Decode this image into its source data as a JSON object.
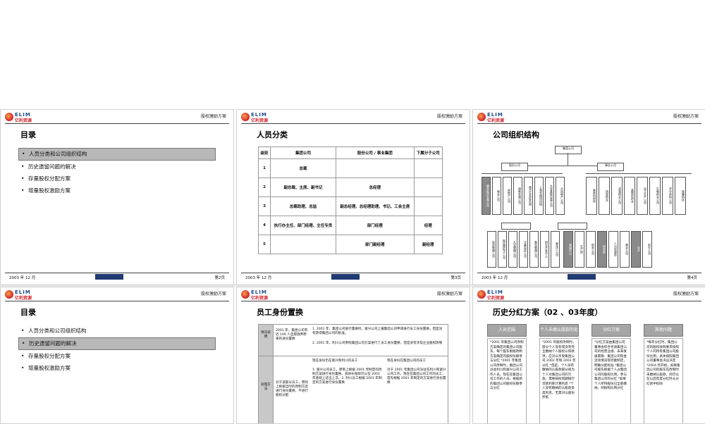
{
  "common": {
    "doc_title": "股权激励方案",
    "date": "2003 年 12 月"
  },
  "slides": [
    {
      "title": "目录",
      "page": "第2页",
      "toc": [
        "人员分类和公司组织结构",
        "历史遗留问题的解决",
        "存量股权分配方案",
        "增量股权激励方案"
      ],
      "active_index": 0
    },
    {
      "title": "人员分类",
      "page": "第3页",
      "table": {
        "headers": [
          "级别",
          "集团公司",
          "股份公司 / 事业集团",
          "下属分子公司"
        ],
        "rows": [
          [
            "1",
            "总裁",
            "",
            ""
          ],
          [
            "2",
            "副总裁、主席、副书记",
            "总经理",
            ""
          ],
          [
            "3",
            "总裁助理、总监",
            "副总经理、总经理助理、书记、工会主席",
            ""
          ],
          [
            "4",
            "执行办主任、部门经理、主任专员",
            "部门经理",
            "经理"
          ],
          [
            "5",
            "",
            "部门副经理",
            "副经理"
          ]
        ]
      }
    },
    {
      "title": "公司组织结构",
      "page": "第4页",
      "org": {
        "top": "集团公司",
        "left_mid": "股份公司",
        "right_mid": "事业公司",
        "left_units": [
          "最多股份有限公司",
          "物业公司",
          "房地产公司",
          "销售有限公司",
          "城市生态综合园",
          "上海仓储项目组",
          "九宝基础设施公司",
          "大连地产公司"
        ],
        "right_units": [
          "高新科研所",
          "西部药业",
          "滤液药业公司",
          "晶制剂药业",
          "化工生产公司",
          "生物药业公司",
          "华中药科公司",
          "保健科技"
        ],
        "left_bottom": [
          "投资管理公司",
          "制造国际子公司",
          "九宝管理公司",
          "泛美投资公司",
          "泰宝管理公司",
          "研究开发中心",
          "泰化工公司"
        ],
        "right_bottom": [
          "营销中心",
          "生产部",
          "财务公司",
          "研发部",
          "人力资源部",
          "营业公司",
          "PPS",
          "部分公司"
        ]
      }
    },
    {
      "title": "目录",
      "page": "",
      "toc": [
        "人员分类和公司组织结构",
        "历史遗留问题的解决",
        "存量股权分配方案",
        "增量股权激励方案"
      ],
      "active_index": 1
    },
    {
      "title": "员工身份置换",
      "page": "",
      "rows": [
        {
          "label": "情况说明",
          "left": "2001 年，集团公司有近 100 人自愿放弃原来的身份置换",
          "notes": [
            "1. 2001 年，集团公司进行置换时，富兴公司上报集团公司申请进行员工身份置换，但是没有获得集团公司的批准。",
            "2. 2001 年，利川公司参照集团公司方案进行了员工身份置换，但是没有涉及企业股权改制"
          ]
        },
        {
          "label": "处理方法",
          "left": "对于该部分员工，原则上根据当时的改制方案进行身份置换，不进行股权分配",
          "col_a": "现在身份仍在富兴和利川的员工",
          "col_b": "现在身份在集团公司的员工",
          "a_text": "1. 富兴公司员工，原则上根据 2001 年制定的改制方案进行身份置换，具体补偿款可以在 2001 年基础上适当上浮。2. 利川员工根据 2001 年制定的方案进行身份置换",
          "b_text": "对于 2001 年集团公司派驻在利川和富兴公司工作，现在在集团公司工作的员工，首先根据 2001 年制定的方案进行身份置换"
        }
      ]
    },
    {
      "title": "历史分红方案（02 、03年度）",
      "page": "",
      "columns": [
        {
          "head": "人员范围",
          "text": "*2001 年集团公司改制方案确定的集团公司股东，每个股东根据改制方案确定的股权份额参与分红 *2001 年集团公司改制时，集团公司派驻利川和富兴公司工作人员，现在在集团公司工作的人员，根据新的集团公司股权份额参与分红"
        },
        {
          "head": "个人未缴认股款的处理",
          "text": "*2001 年股权改制时，部分个人没有或没有完全缴纳个人股权认购款项，应对以享受集团公司 2002 年和 2003 年分红 *但是，个人没有缴纳的认股款部分视为个人对集团公司的欠款，需要按照同期银行贷款利率计算利息 *个人没有缴纳的认股款及其利息，无需对以股份折抵"
        },
        {
          "head": "分红方案",
          "text": "*分红方案由集团公司董事会综合考虑集团公司的经营业绩、未来发展需要、集团公司现金流动情况等因素制定，明确分配标准 *集团公司股东根据个人占集团公司的股权比例，参与集团公司的分红 *如果个人所持股份已全部缴纳，则按照比例分红"
        },
        {
          "head": "其他问题",
          "text": "*每年分红时，集团公司的股权收购要求按照个人的持有集团公司股份比例，具体按照集团公司董事会决议决定 *2004 年开始，如果集团公司的股东在改制时未缴纳认股款，则可以在以后年度分红时从分红款中扣除"
        }
      ]
    }
  ]
}
